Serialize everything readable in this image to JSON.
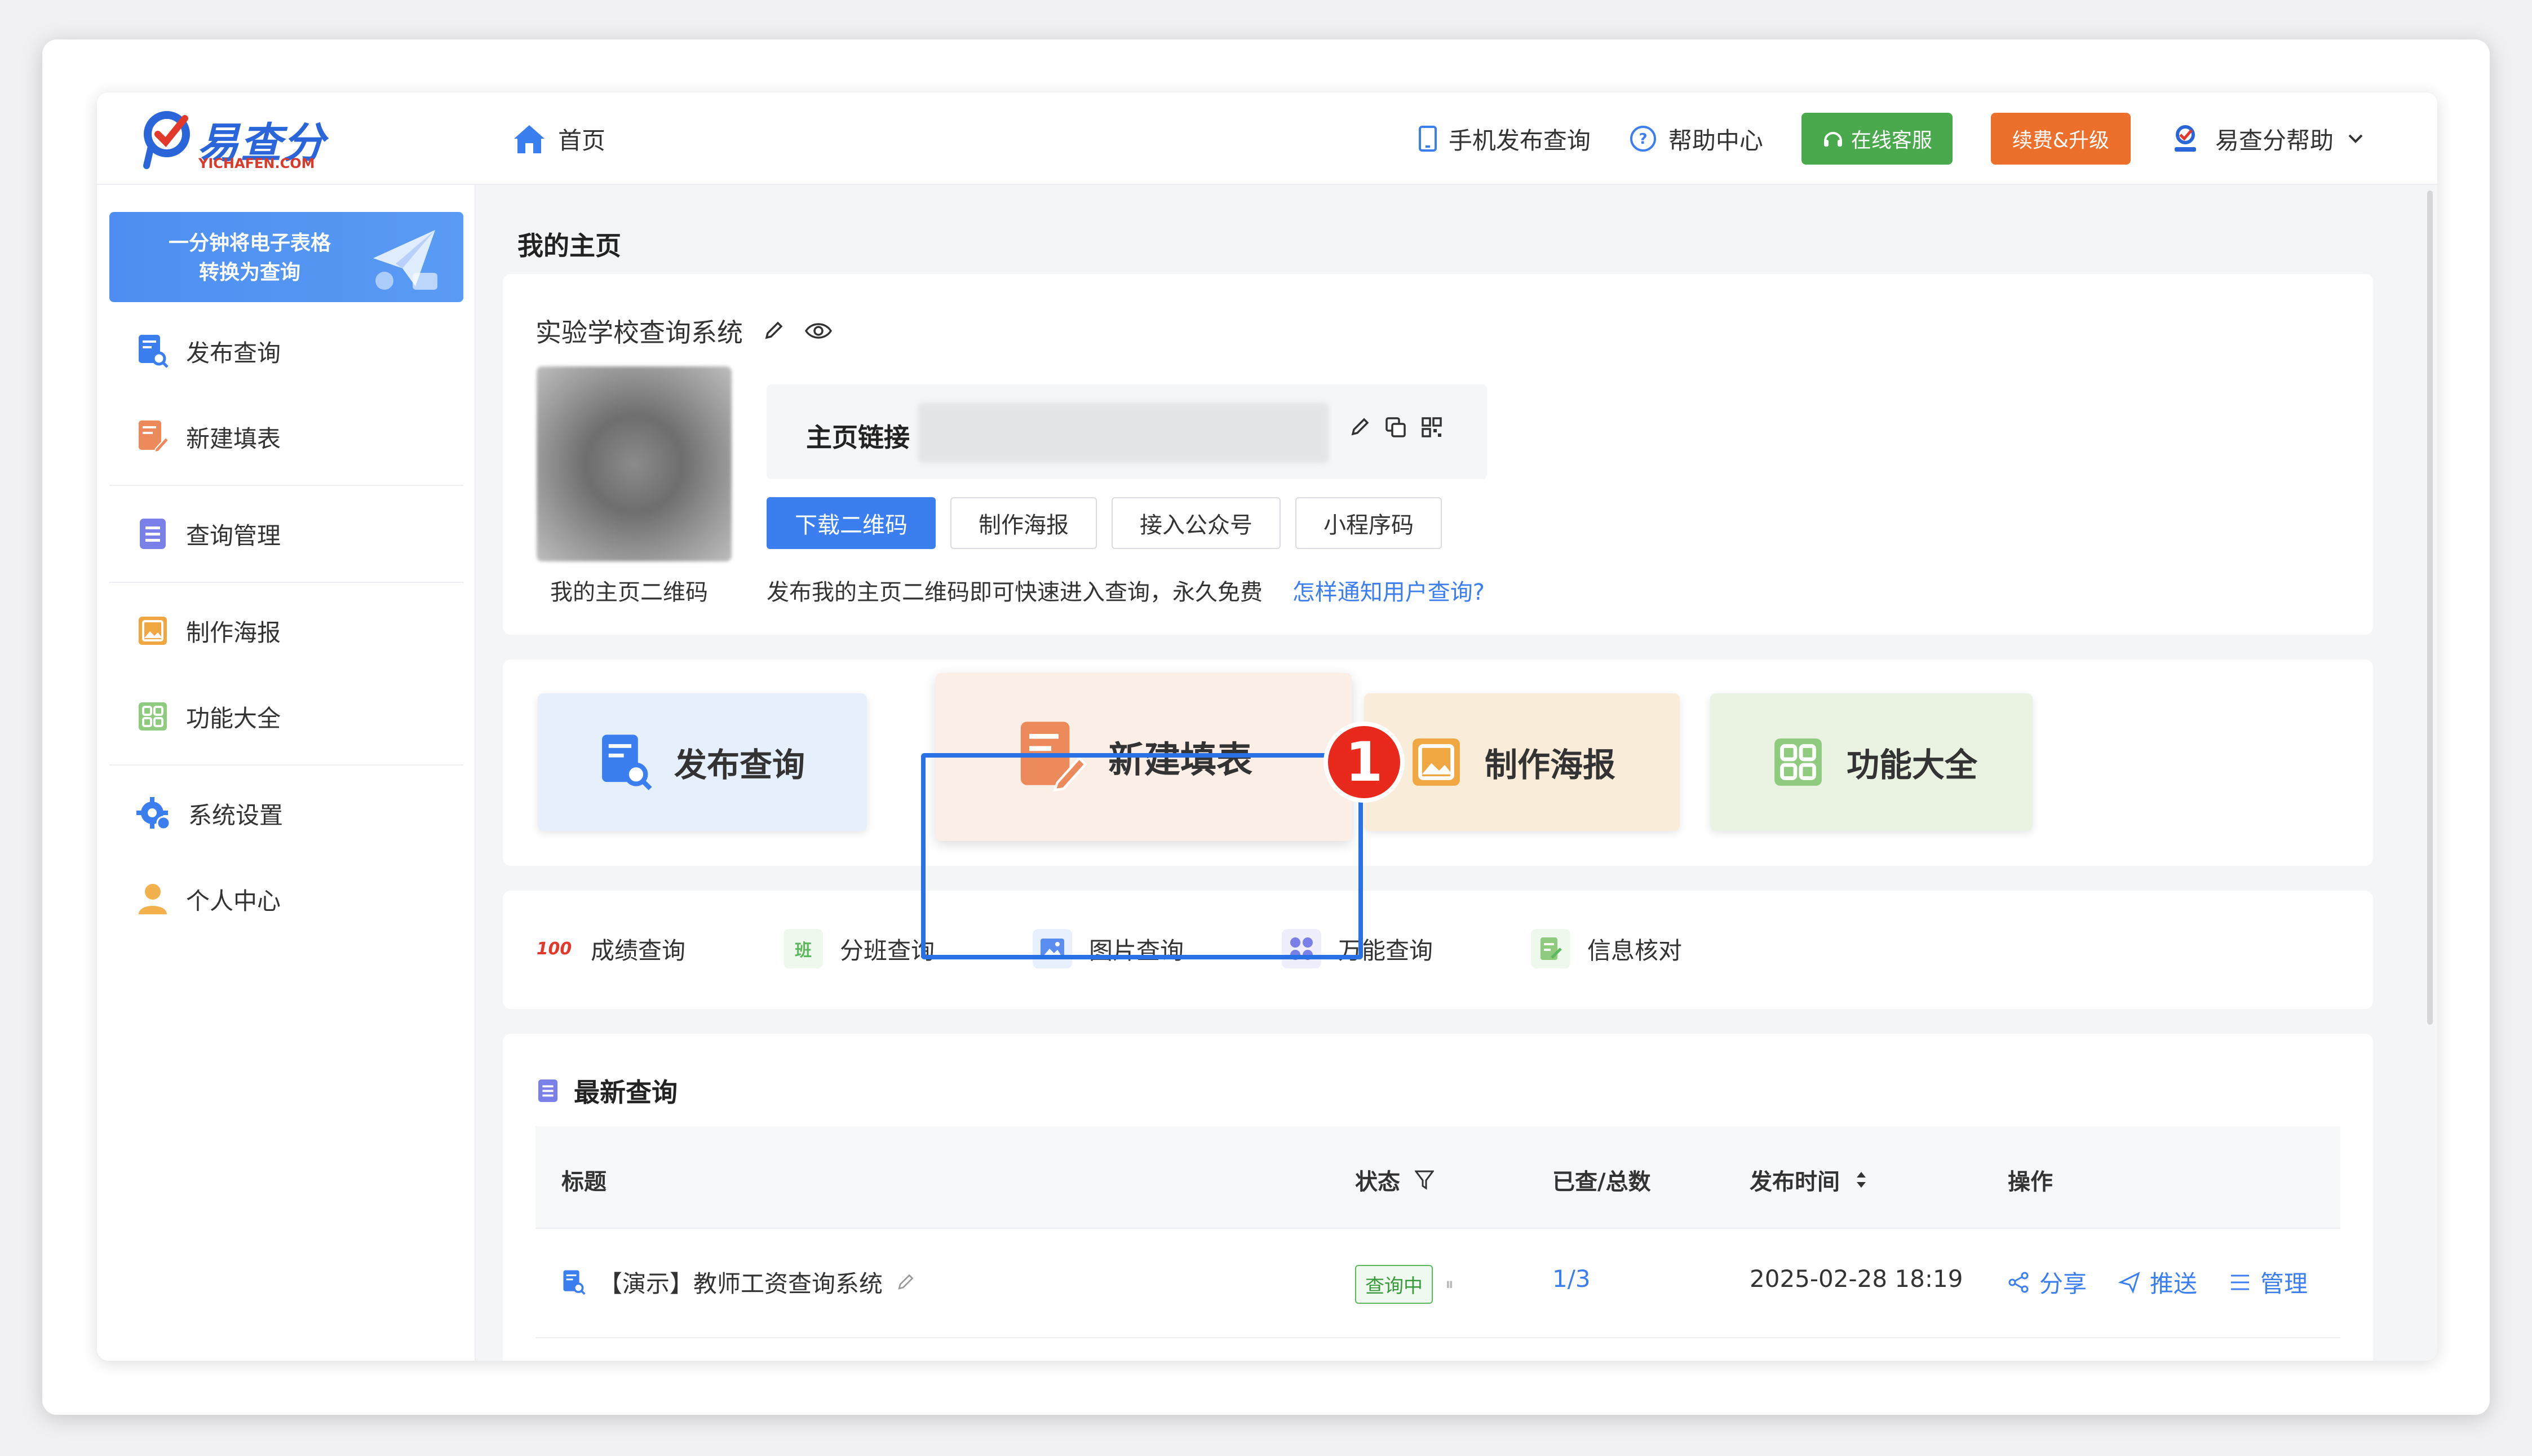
{
  "header": {
    "brand": "易查分",
    "brand_sub": "YICHAFEN.COM",
    "home": "首页",
    "mobile_publish": "手机发布查询",
    "help_center": "帮助中心",
    "online_service": "在线客服",
    "renew": "续费&升级",
    "user_name": "易查分帮助"
  },
  "sidebar": {
    "banner": "一分钟将电子表格\n转换为查询",
    "items": [
      {
        "label": "发布查询"
      },
      {
        "label": "新建填表"
      },
      {
        "label": "查询管理"
      },
      {
        "label": "制作海报"
      },
      {
        "label": "功能大全"
      },
      {
        "label": "系统设置"
      },
      {
        "label": "个人中心"
      }
    ]
  },
  "main": {
    "page_title": "我的主页",
    "system_name": "实验学校查询系统",
    "qr_label": "我的主页二维码",
    "link_label": "主页链接",
    "buttons": [
      "下载二维码",
      "制作海报",
      "接入公众号",
      "小程序码"
    ],
    "hint": "发布我的主页二维码即可快速进入查询，永久免费",
    "hint_link": "怎样通知用户查询?",
    "features": [
      {
        "label": "发布查询"
      },
      {
        "label": "新建填表"
      },
      {
        "label": "制作海报"
      },
      {
        "label": "功能大全"
      }
    ],
    "step_badge": "1",
    "quick_types": [
      {
        "label": "成绩查询",
        "icon_text": "100"
      },
      {
        "label": "分班查询",
        "icon_text": "班"
      },
      {
        "label": "图片查询"
      },
      {
        "label": "万能查询"
      },
      {
        "label": "信息核对"
      }
    ],
    "latest": {
      "title": "最新查询",
      "columns": [
        "标题",
        "状态",
        "已查/总数",
        "发布时间",
        "操作"
      ],
      "rows": [
        {
          "title": "【演示】教师工资查询系统",
          "status": "查询中",
          "count": "1/3",
          "time": "2025-02-28 18:19",
          "actions": [
            "分享",
            "推送",
            "管理"
          ]
        }
      ]
    }
  }
}
